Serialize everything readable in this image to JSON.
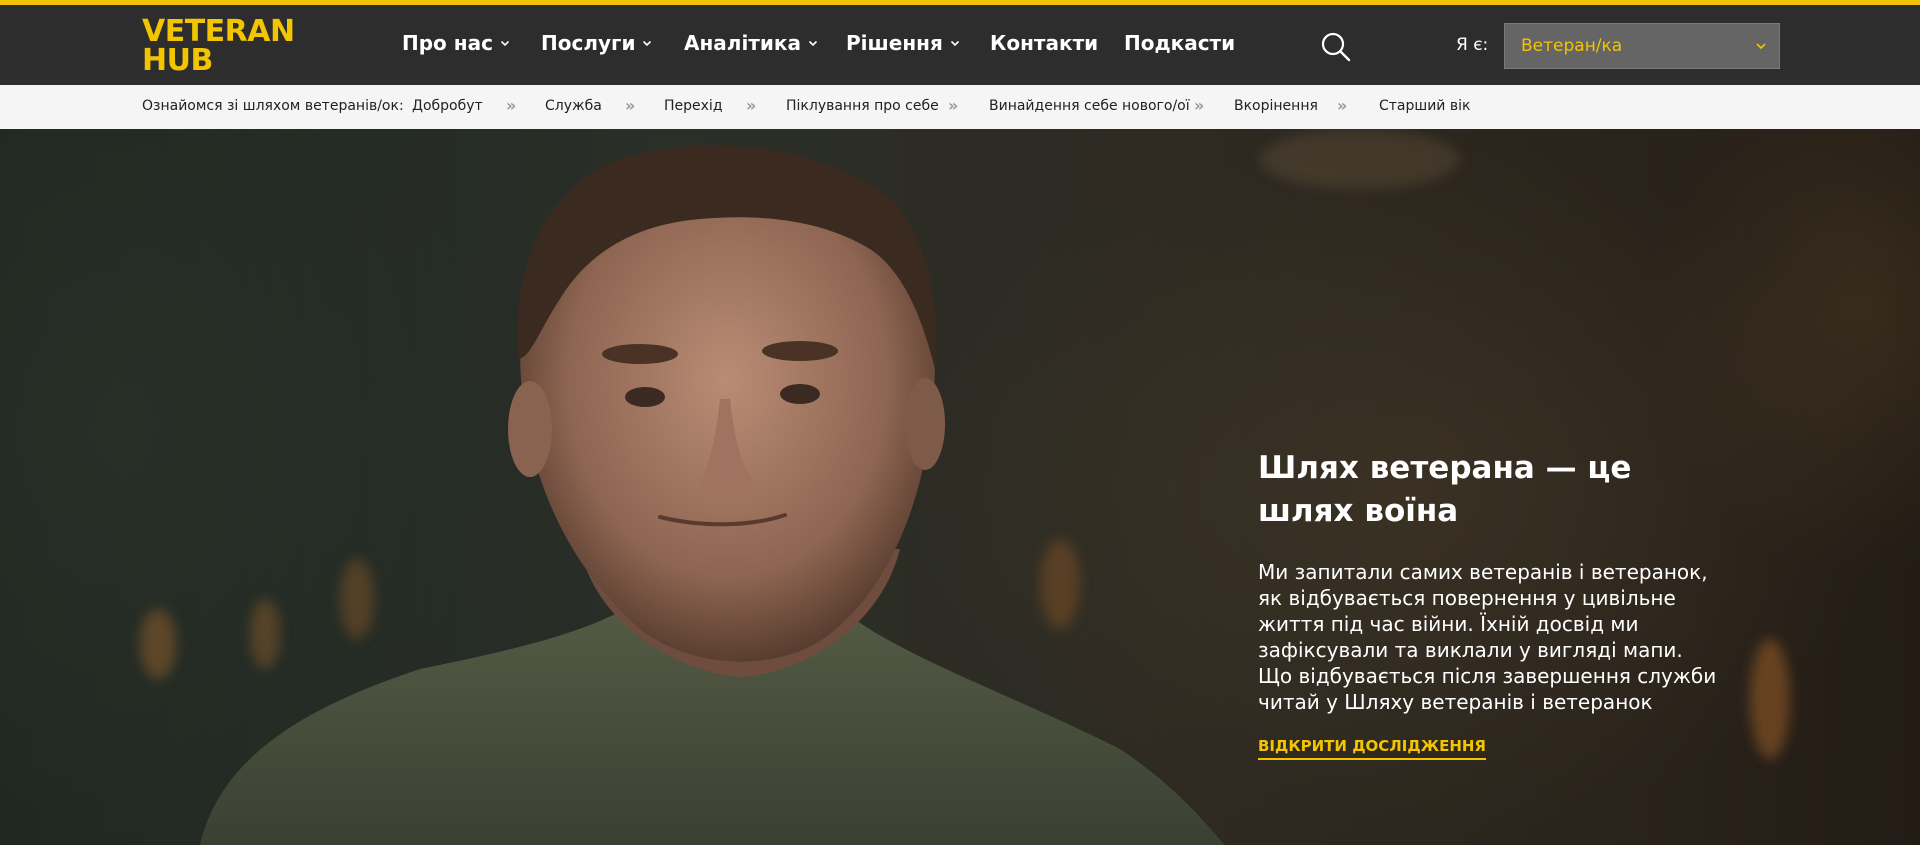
{
  "header": {
    "logo_line1": "VETERAN",
    "logo_line2": "HUB",
    "nav": [
      {
        "label": "Про нас",
        "has_dropdown": true
      },
      {
        "label": "Послуги",
        "has_dropdown": true
      },
      {
        "label": "Аналітика",
        "has_dropdown": true
      },
      {
        "label": "Рішення",
        "has_dropdown": true
      },
      {
        "label": "Контакти",
        "has_dropdown": false
      },
      {
        "label": "Подкасти",
        "has_dropdown": false
      }
    ],
    "search_icon": "search-icon",
    "iam_label": "Я є:",
    "iam_select_value": "Ветеран/ка"
  },
  "pathbar": {
    "label": "Ознайомся зі шляхом ветеранів/ок:",
    "separator": "»",
    "steps": [
      "Добробут",
      "Служба",
      "Перехід",
      "Піклування про себе",
      "Винайдення себе нового/ої",
      "Вкорінення",
      "Старший вік"
    ]
  },
  "hero": {
    "title": "Шлях ветерана — це шлях воїна",
    "description": "Ми запитали самих ветеранів і ветеранок, як відбувається повернення у цивільне життя під час війни. Їхній досвід ми зафіксували та виклали у вигляді мапи. Що відбувається після завершення служби читай у Шляху ветеранів і ветеранок",
    "cta": "ВІДКРИТИ ДОСЛІДЖЕННЯ"
  },
  "colors": {
    "accent": "#f2c500",
    "header_bg": "#2d2d2d",
    "pathbar_bg": "#f5f5f5",
    "select_bg": "#656565"
  }
}
